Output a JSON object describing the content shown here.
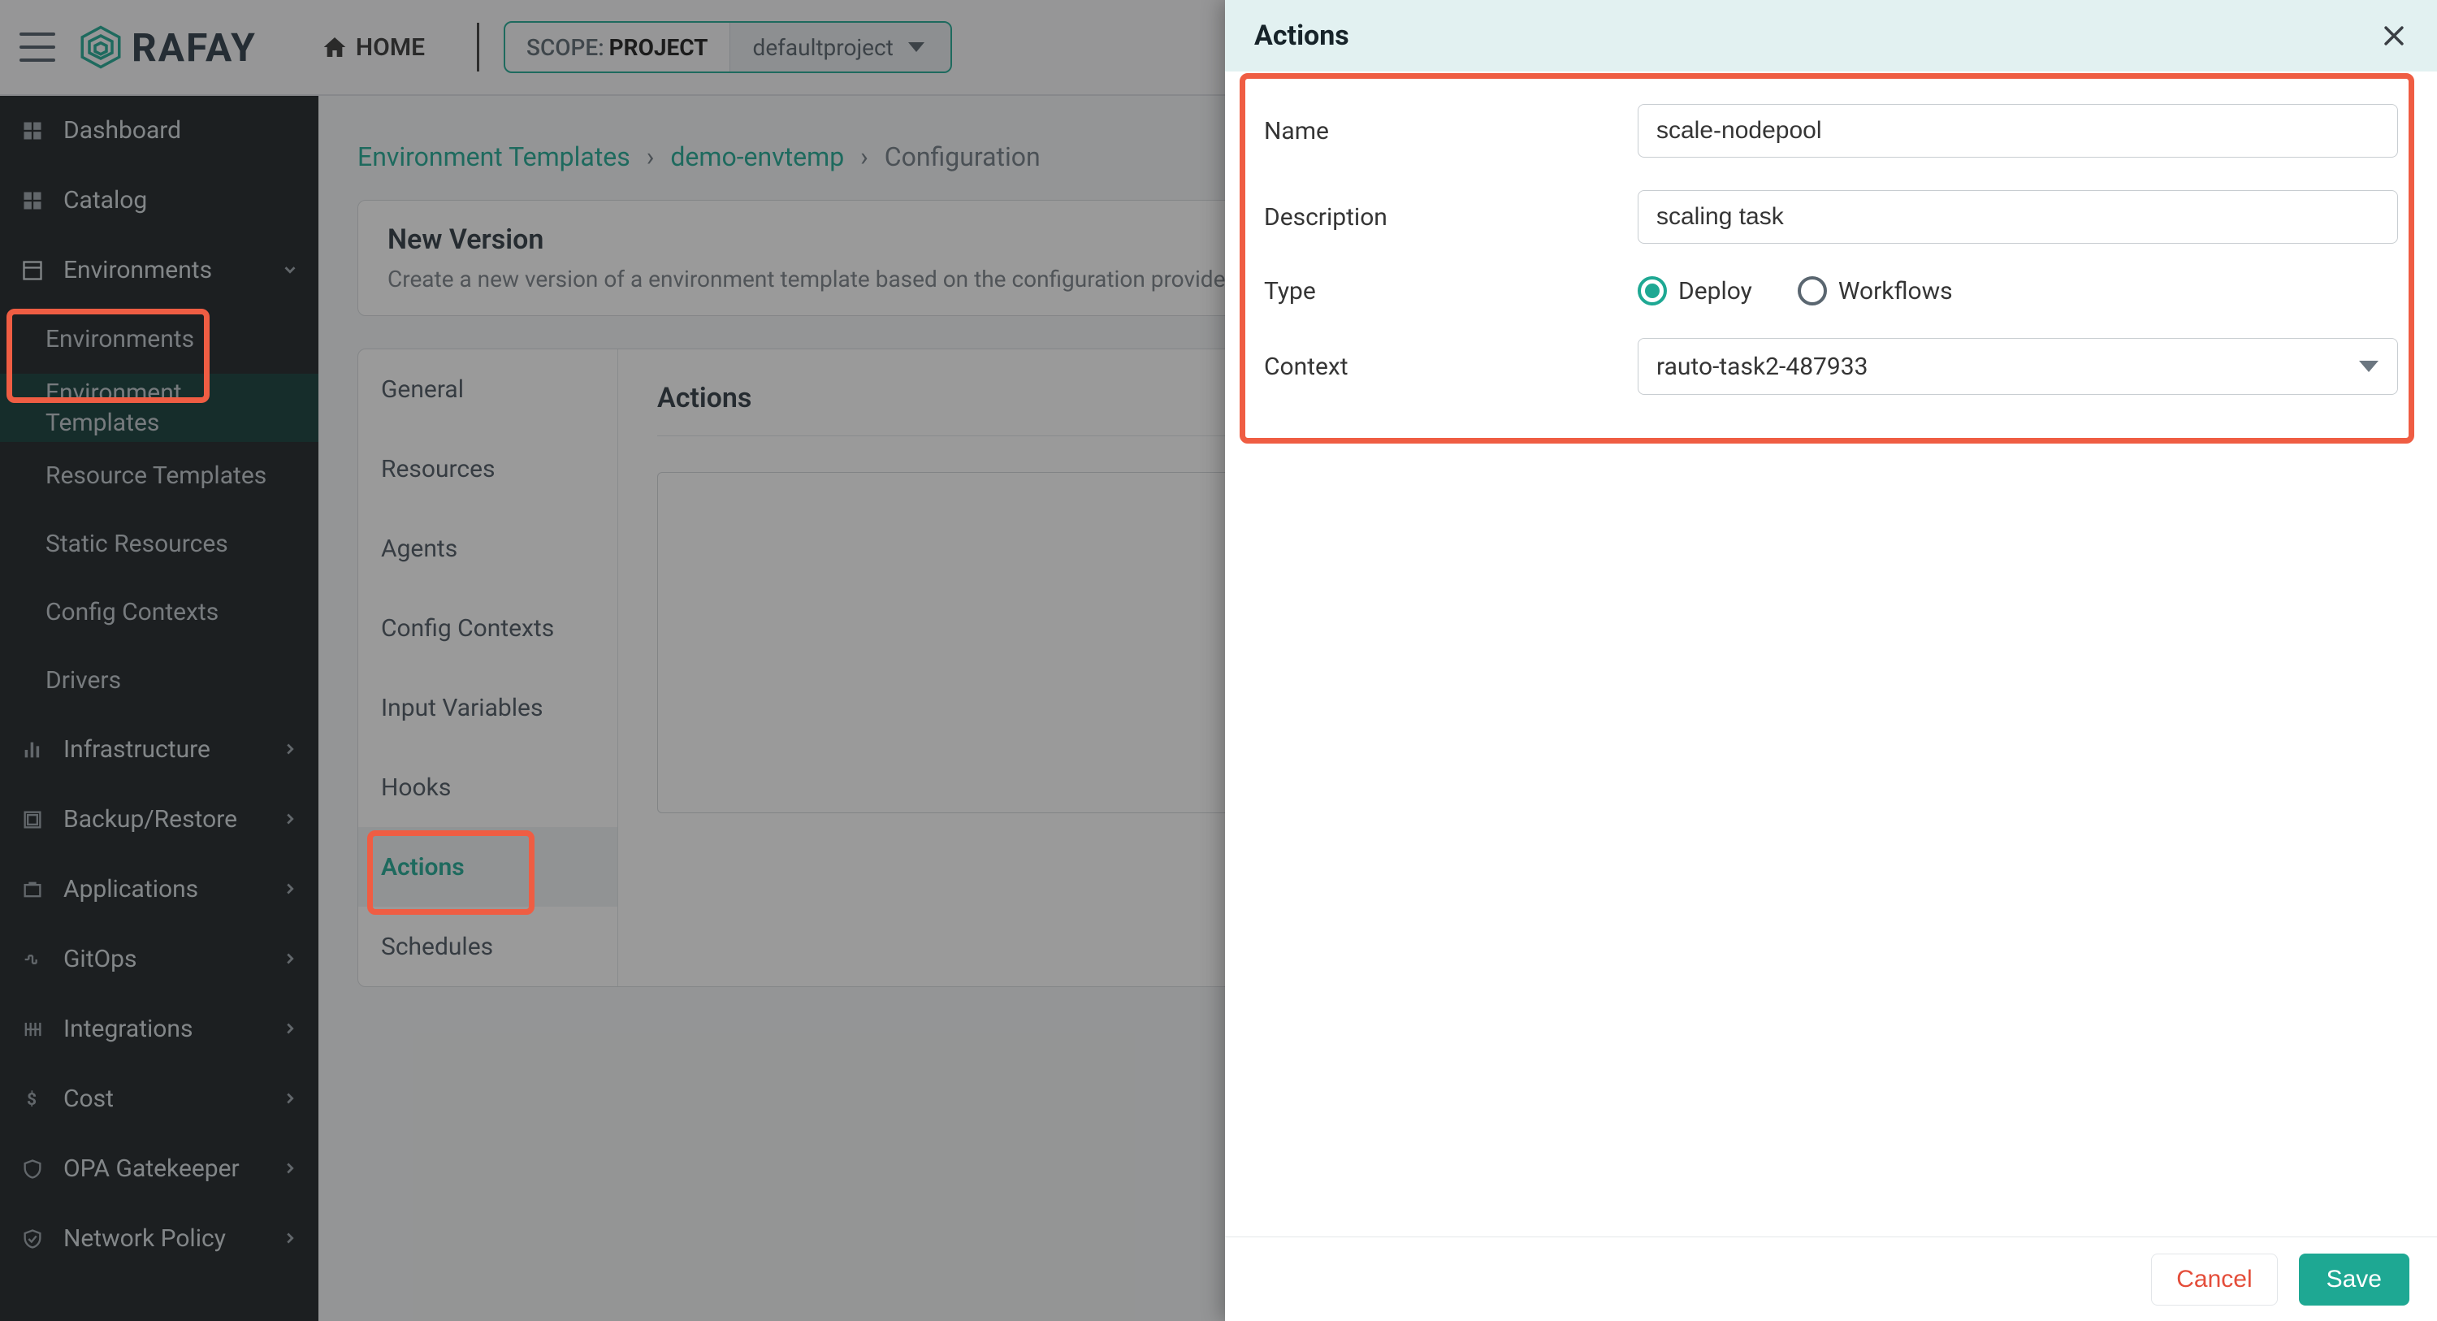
{
  "brand": {
    "name": "RAFAY"
  },
  "topbar": {
    "home_label": "HOME",
    "scope_label": "SCOPE:",
    "scope_value": "PROJECT",
    "project_name": "defaultproject"
  },
  "sidebar": {
    "dashboard": "Dashboard",
    "catalog": "Catalog",
    "environments": "Environments",
    "env_children": {
      "environments": "Environments",
      "env_templates": "Environment Templates",
      "resource_templates": "Resource Templates",
      "static_resources": "Static Resources",
      "config_contexts": "Config Contexts",
      "drivers": "Drivers"
    },
    "infrastructure": "Infrastructure",
    "backup_restore": "Backup/Restore",
    "applications": "Applications",
    "gitops": "GitOps",
    "integrations": "Integrations",
    "cost": "Cost",
    "opa": "OPA Gatekeeper",
    "network_policy": "Network Policy"
  },
  "breadcrumb": {
    "root": "Environment Templates",
    "item": "demo-envtemp",
    "current": "Configuration"
  },
  "new_version": {
    "title": "New Version",
    "desc": "Create a new version of a environment template based on the configuration provided"
  },
  "config_tabs": {
    "general": "General",
    "resources": "Resources",
    "agents": "Agents",
    "config_contexts": "Config Contexts",
    "input_variables": "Input Variables",
    "hooks": "Hooks",
    "actions": "Actions",
    "schedules": "Schedules"
  },
  "panel_header": "Actions",
  "drawer": {
    "title": "Actions",
    "form": {
      "name_label": "Name",
      "name_value": "scale-nodepool",
      "desc_label": "Description",
      "desc_value": "scaling task",
      "type_label": "Type",
      "type_deploy": "Deploy",
      "type_workflows": "Workflows",
      "type_selected": "Deploy",
      "context_label": "Context",
      "context_value": "rauto-task2-487933"
    },
    "cancel": "Cancel",
    "save": "Save"
  },
  "colors": {
    "accent": "#1ea893",
    "warn": "#e44d3a",
    "highlight": "#ef5d43"
  }
}
